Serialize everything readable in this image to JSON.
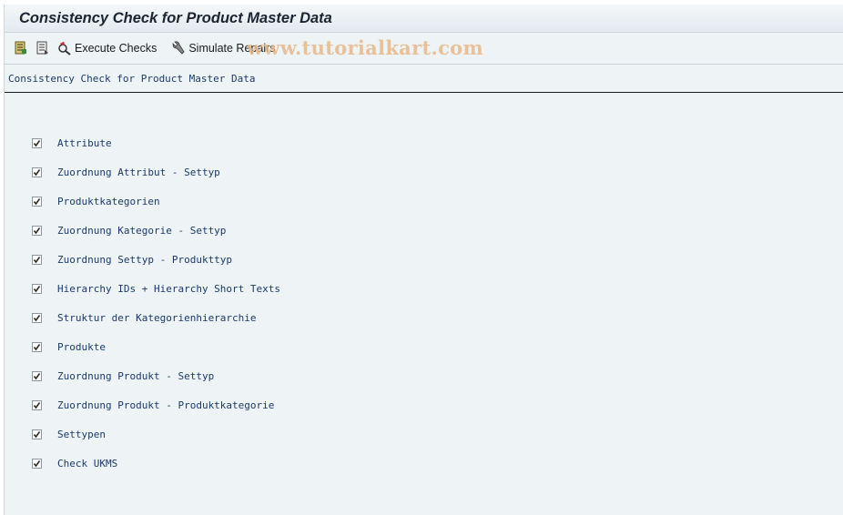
{
  "window": {
    "title": "Consistency Check for Product Master Data"
  },
  "toolbar": {
    "execute_checks_label": "Execute Checks",
    "simulate_repairs_label": "Simulate Repairs",
    "watermark": "www.tutorialkart.com"
  },
  "section": {
    "header": "Consistency Check for Product Master Data"
  },
  "checks": [
    {
      "label": "Attribute",
      "checked": true
    },
    {
      "label": "Zuordnung Attribut - Settyp",
      "checked": true
    },
    {
      "label": "Produktkategorien",
      "checked": true
    },
    {
      "label": "Zuordnung Kategorie - Settyp",
      "checked": true
    },
    {
      "label": "Zuordnung Settyp - Produkttyp",
      "checked": true
    },
    {
      "label": "Hierarchy IDs + Hierarchy Short Texts",
      "checked": true
    },
    {
      "label": "Struktur der Kategorienhierarchie",
      "checked": true
    },
    {
      "label": "Produkte",
      "checked": true
    },
    {
      "label": "Zuordnung Produkt - Settyp",
      "checked": true
    },
    {
      "label": "Zuordnung Produkt - Produktkategorie",
      "checked": true
    },
    {
      "label": "Settypen",
      "checked": true
    },
    {
      "label": "Check UKMS",
      "checked": true
    }
  ],
  "colors": {
    "accent_text": "#1b3a6b",
    "background": "#eef3f6"
  }
}
